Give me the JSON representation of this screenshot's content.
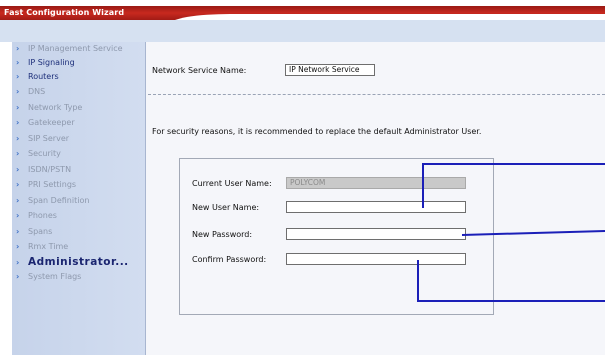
{
  "window": {
    "title": "Fast Configuration Wizard"
  },
  "sidebar": {
    "items": [
      {
        "label": "IP Management Service",
        "state": "disabled"
      },
      {
        "label": "IP Signaling",
        "state": "enabled"
      },
      {
        "label": "Routers",
        "state": "enabled"
      },
      {
        "label": "DNS",
        "state": "disabled"
      },
      {
        "label": "Network Type",
        "state": "disabled"
      },
      {
        "label": "Gatekeeper",
        "state": "disabled"
      },
      {
        "label": "SIP Server",
        "state": "disabled"
      },
      {
        "label": "Security",
        "state": "disabled"
      },
      {
        "label": "ISDN/PSTN",
        "state": "disabled"
      },
      {
        "label": "PRI Settings",
        "state": "disabled"
      },
      {
        "label": "Span Definition",
        "state": "disabled"
      },
      {
        "label": "Phones",
        "state": "disabled"
      },
      {
        "label": "Spans",
        "state": "disabled"
      },
      {
        "label": "Rmx Time",
        "state": "disabled"
      },
      {
        "label": "Administrator...",
        "state": "active"
      },
      {
        "label": "System Flags",
        "state": "disabled"
      }
    ],
    "arrow_icon": "chevron-right-icon"
  },
  "form": {
    "network_service_label": "Network Service Name:",
    "network_service_value": "IP Network Service",
    "security_note": "For security reasons, it is recommended to replace the default Administrator User.",
    "current_user_label": "Current User Name:",
    "current_user_value": "POLYCOM",
    "new_user_label": "New User Name:",
    "new_user_value": "",
    "new_password_label": "New Password:",
    "new_password_value": "",
    "confirm_password_label": "Confirm Password:",
    "confirm_password_value": ""
  },
  "colors": {
    "title_bar": "#b02019",
    "sidebar_bg": "#c9d5eb",
    "callout_line": "#1b1fb8"
  }
}
